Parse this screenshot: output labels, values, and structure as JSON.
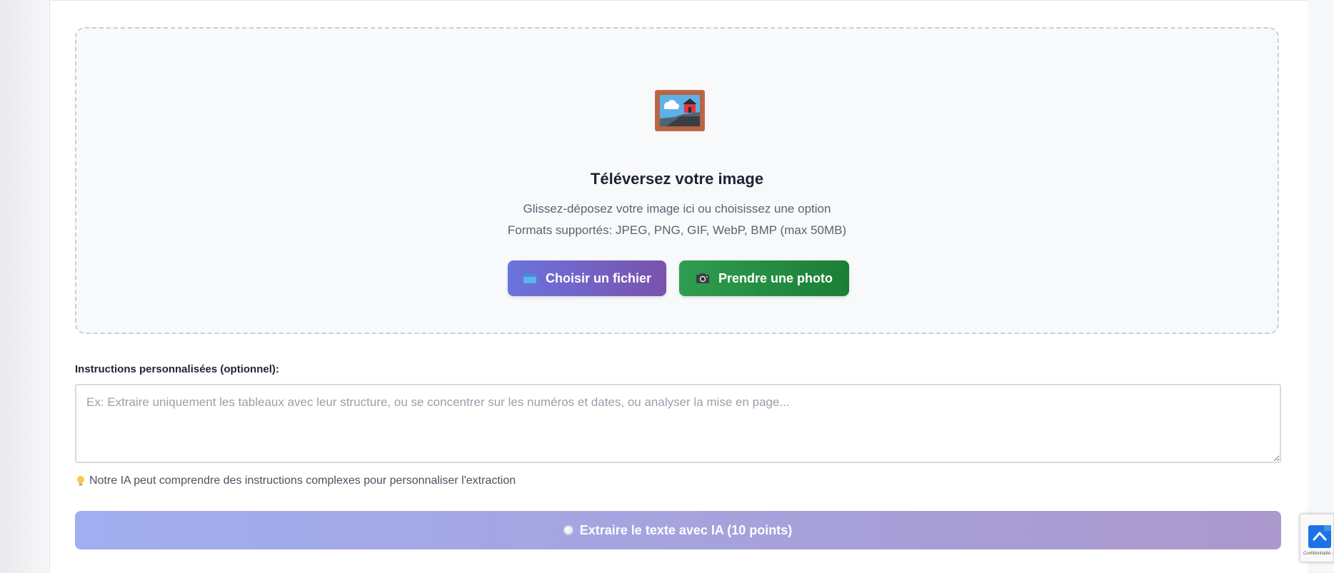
{
  "upload": {
    "title": "Téléversez votre image",
    "subtitle": "Glissez-déposez votre image ici ou choisissez une option",
    "formats": "Formats supportés: JPEG, PNG, GIF, WebP, BMP (max 50MB)",
    "choose_file_label": "Choisir un fichier",
    "take_photo_label": "Prendre une photo",
    "icons": {
      "main": "framed-picture-icon",
      "choose_file": "folder-icon",
      "take_photo": "camera-icon"
    }
  },
  "instructions": {
    "label": "Instructions personnalisées (optionnel):",
    "value": "",
    "placeholder": "Ex: Extraire uniquement les tableaux avec leur structure, ou se concentrer sur les numéros et dates, ou analyser la mise en page...",
    "hint": "Notre IA peut comprendre des instructions complexes pour personnaliser l'extraction",
    "hint_icon": "lightbulb-icon"
  },
  "submit": {
    "label": "Extraire le texte avec IA (10 points)",
    "icon": "loading-spinner-icon",
    "disabled": true
  },
  "recaptcha": {
    "text": "Confidentialité -",
    "icon": "recaptcha-icon"
  },
  "colors": {
    "choose_file_start": "#6a74dd",
    "choose_file_end": "#7a52ad",
    "take_photo_start": "#2f9d4f",
    "take_photo_end": "#1c7e36",
    "submit_start": "#a1aef0",
    "submit_end": "#ab98cc",
    "dropzone_border": "#c5cfe0",
    "dropzone_bg": "#f8f9fb"
  }
}
